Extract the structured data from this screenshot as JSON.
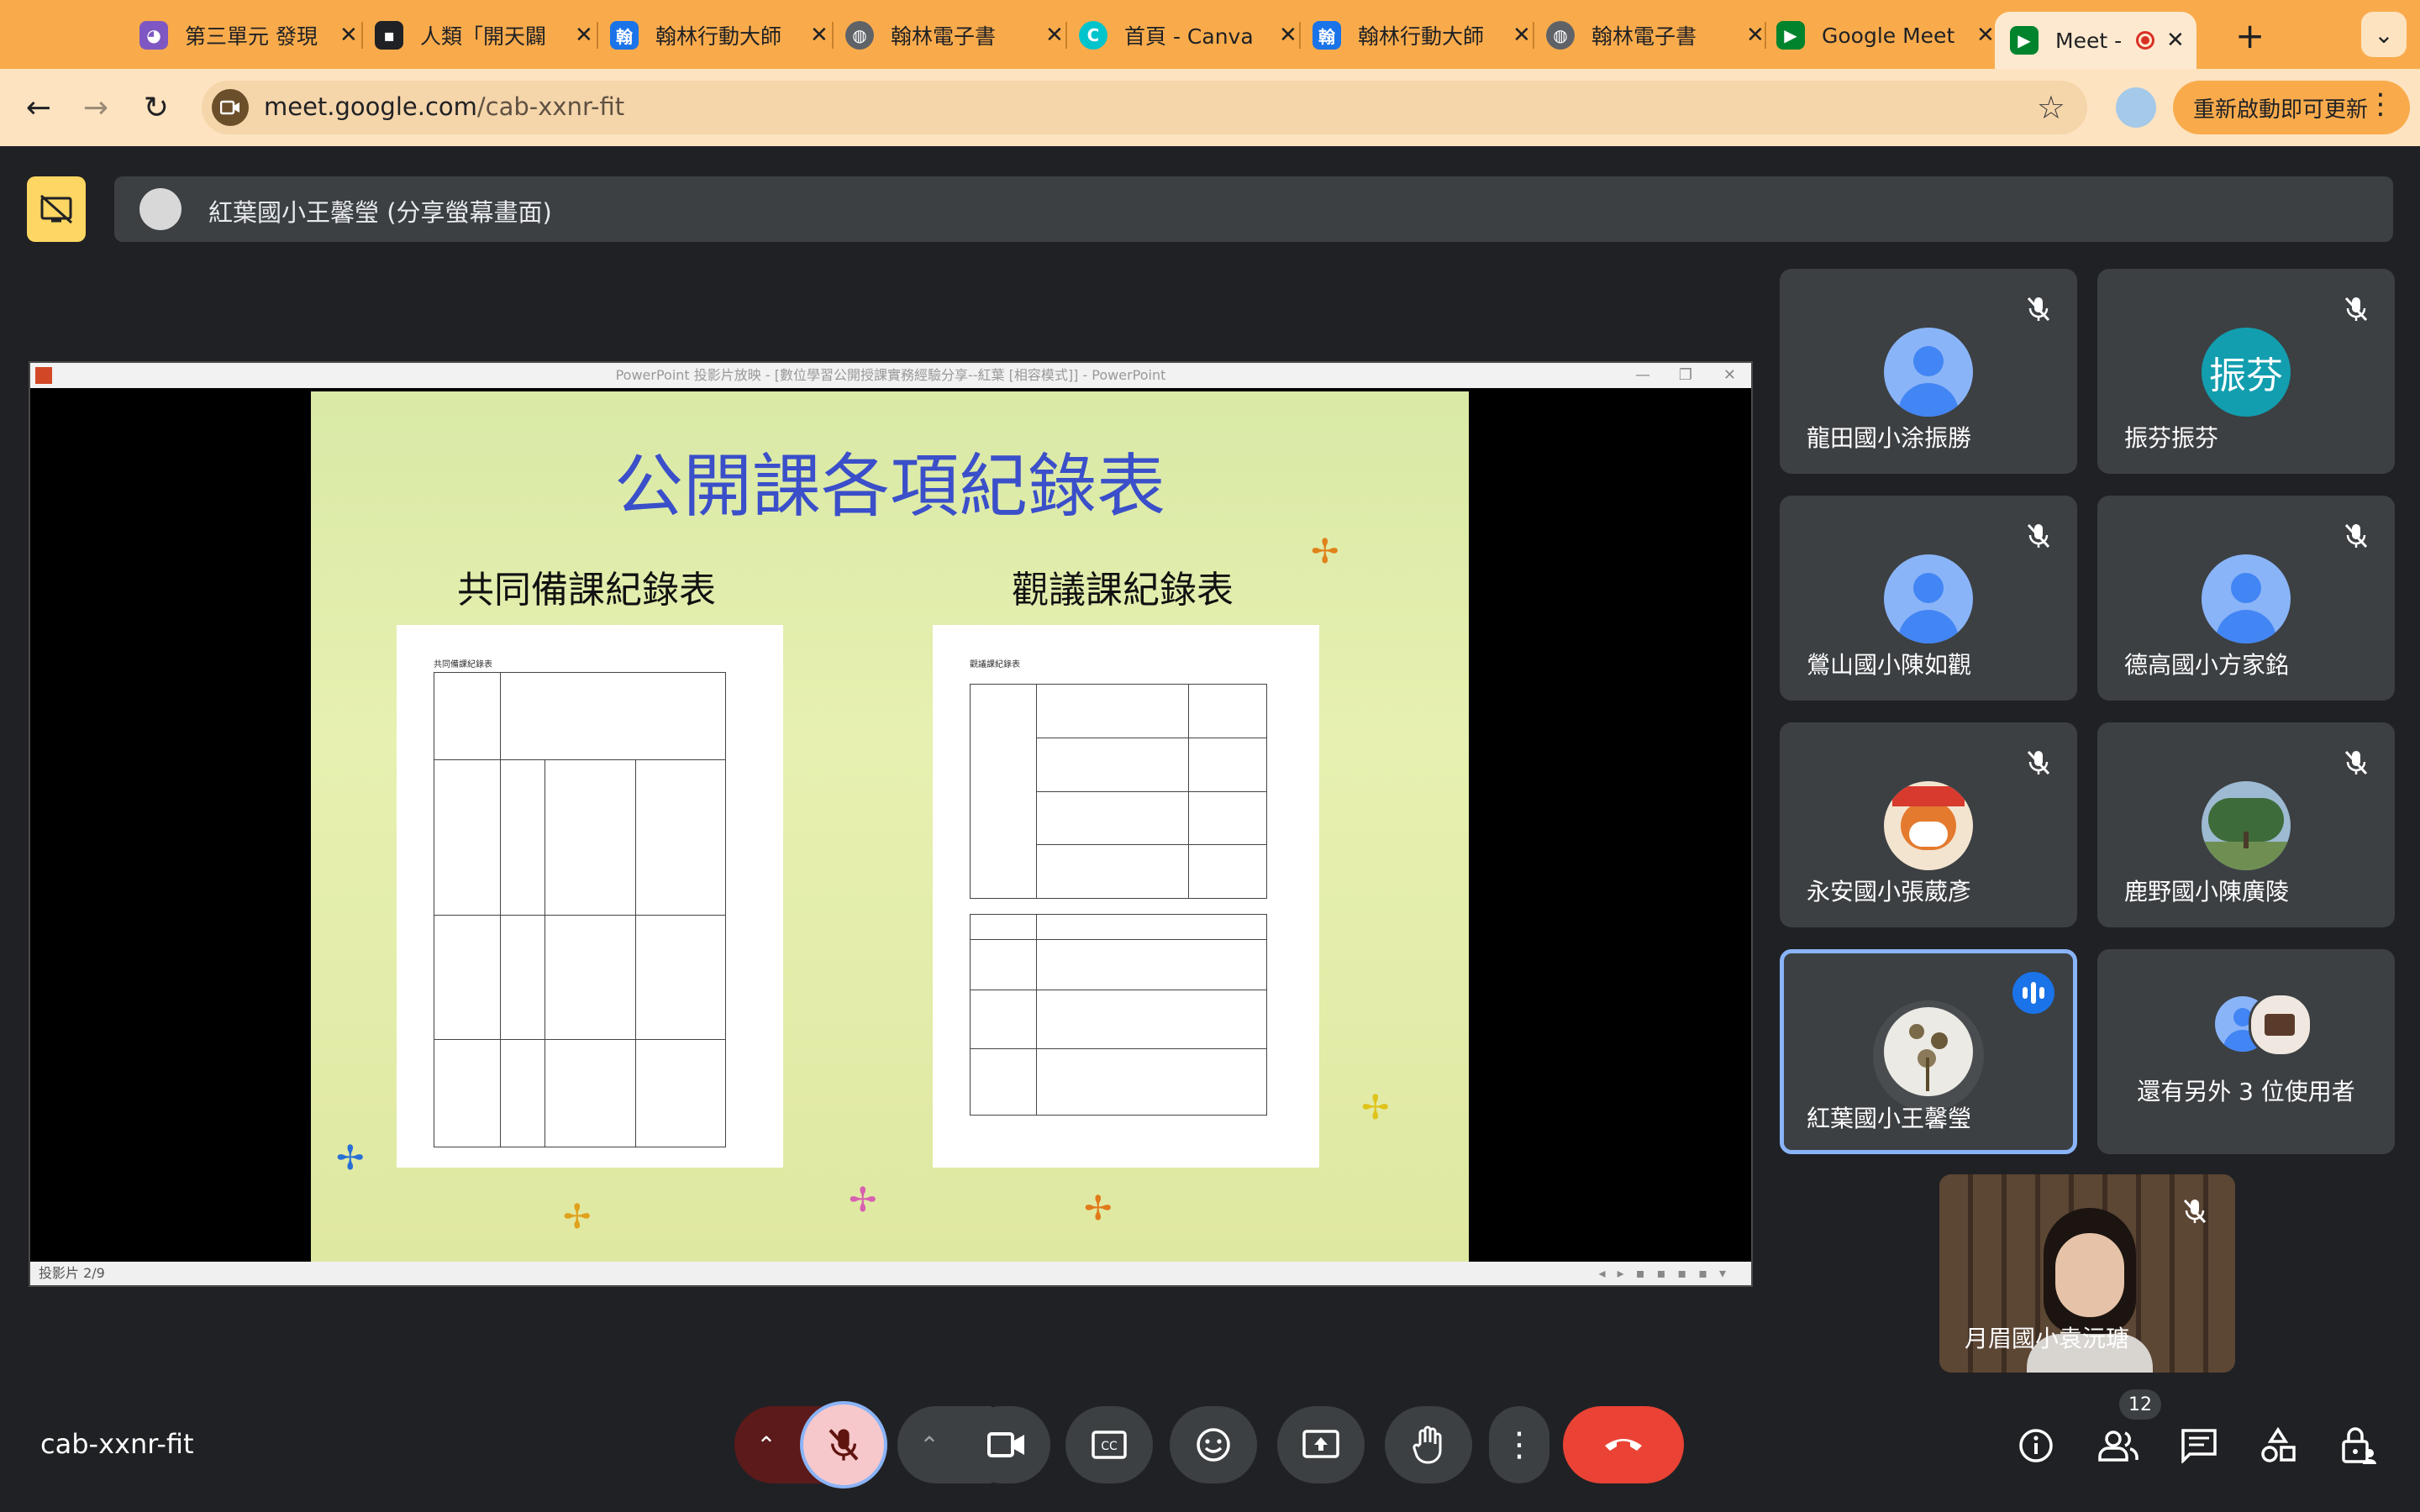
{
  "browser": {
    "tabs": [
      {
        "title": "第三單元 發現",
        "color": "#7e57c2"
      },
      {
        "title": "人類「開天闢",
        "color": "#202124"
      },
      {
        "title": "翰林行動大師",
        "color": "#1a73e8"
      },
      {
        "title": "翰林電子書",
        "color": "#5f6368"
      },
      {
        "title": "首頁 - Canva",
        "color": "#00c4cc"
      },
      {
        "title": "翰林行動大師",
        "color": "#1a73e8"
      },
      {
        "title": "翰林電子書",
        "color": "#5f6368"
      },
      {
        "title": "Google Meet",
        "color": "#00832d"
      },
      {
        "title": "Meet - c",
        "color": "#00832d"
      }
    ],
    "url_host": "meet.google.com",
    "url_path": "/cab-xxnr-fit",
    "update_label": "重新啟動即可更新"
  },
  "meet": {
    "presenter_banner": "紅葉國小王馨瑩 (分享螢幕畫面)",
    "ppt_window_title": "PowerPoint 投影片放映 - [數位學習公開授課實務經驗分享--紅葉 [相容模式]] - PowerPoint",
    "slide": {
      "title": "公開課各項紀錄表",
      "left_heading": "共同備課紀錄表",
      "right_heading": "觀議課紀錄表",
      "left_doc_header": "共同備課紀錄表",
      "right_doc_header": "觀議課紀錄表"
    },
    "slide_status": "投影片 2/9",
    "participants": [
      {
        "name": "龍田國小涂振勝",
        "avatar": "default"
      },
      {
        "name": "振芬振芬",
        "avatar": "text",
        "initial": "振芬"
      },
      {
        "name": "鶯山國小陳如觀",
        "avatar": "default"
      },
      {
        "name": "德高國小方家銘",
        "avatar": "default"
      },
      {
        "name": "永安國小張葳彥",
        "avatar": "photo"
      },
      {
        "name": "鹿野國小陳廣陵",
        "avatar": "photo"
      },
      {
        "name": "紅葉國小王馨瑩",
        "avatar": "photo",
        "speaking": true
      }
    ],
    "more_users": "還有另外 3 位使用者",
    "self_name": "月眉國小袁沅瑭",
    "meeting_code": "cab-xxnr-fit",
    "people_count": "12",
    "colors": {
      "accent": "#8ab4f8",
      "leave": "#ea4335",
      "chrome": "#f9ab4c"
    }
  }
}
